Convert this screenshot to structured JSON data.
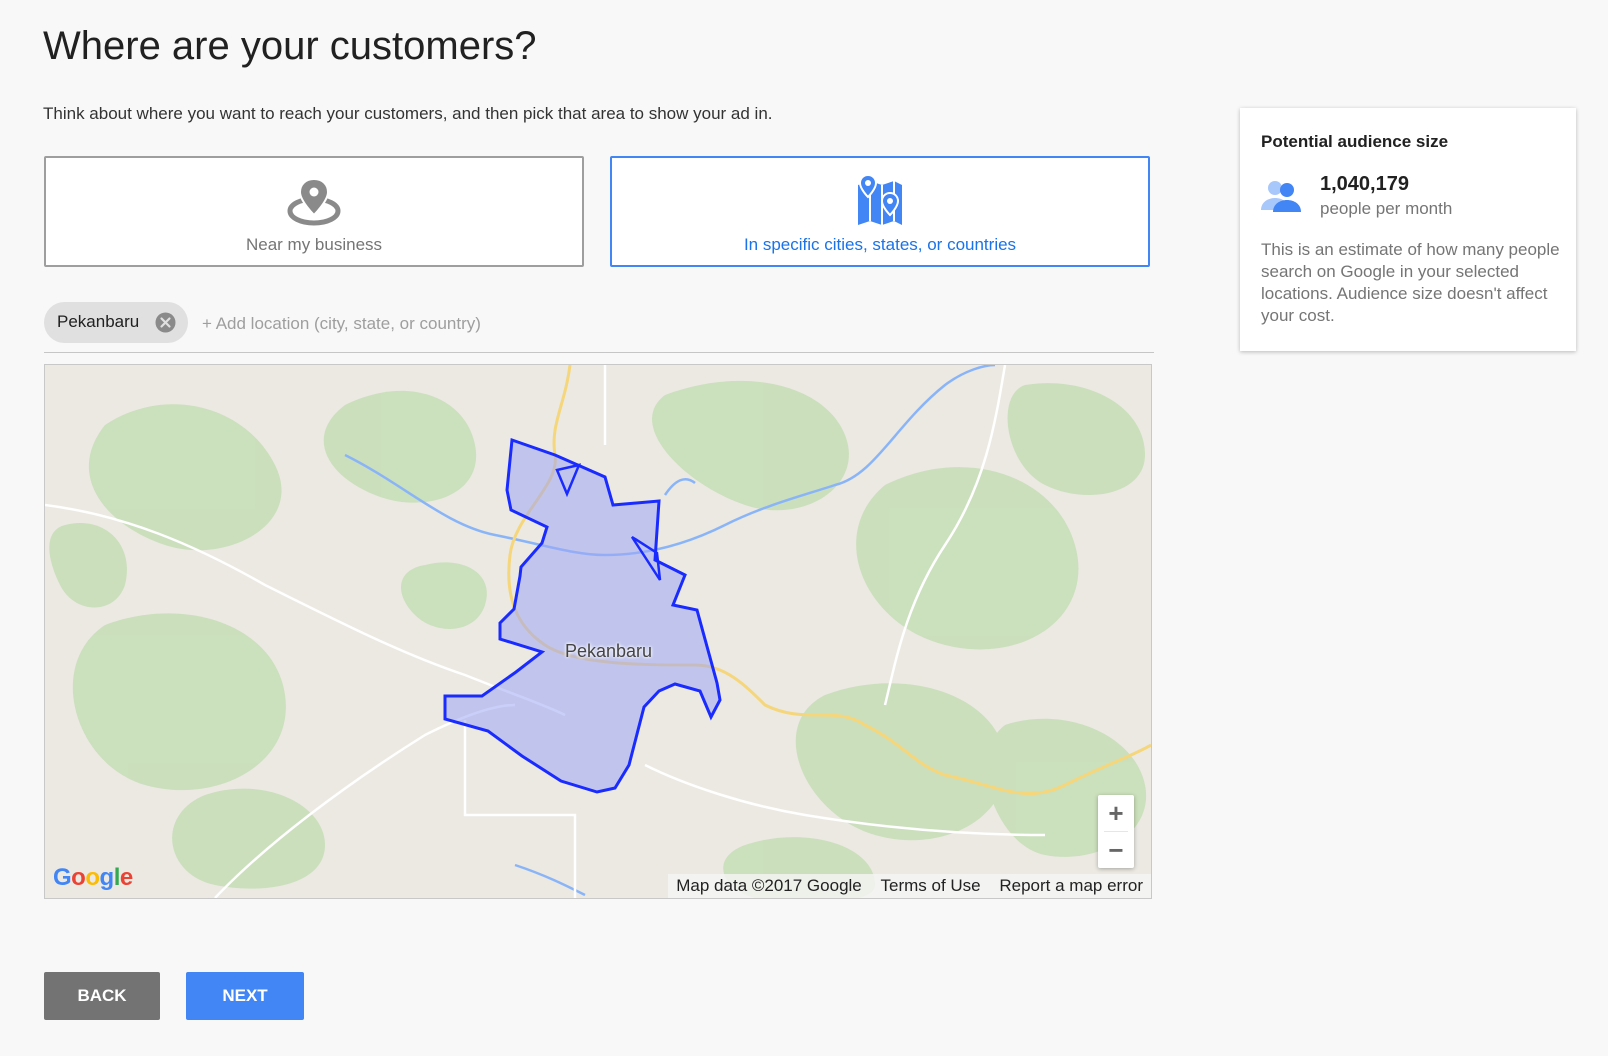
{
  "page": {
    "title": "Where are your customers?",
    "subtitle": "Think about where you want to reach your customers, and then pick that area to show your ad in."
  },
  "options": {
    "near": {
      "label": "Near my business",
      "icon": "location-target-icon",
      "selected": false
    },
    "specific": {
      "label": "In specific cities, states, or countries",
      "icon": "map-pins-icon",
      "selected": true
    }
  },
  "location": {
    "chips": [
      "Pekanbaru"
    ],
    "placeholder": "+ Add location (city, state, or country)"
  },
  "map": {
    "city_label": "Pekanbaru",
    "zoom_in": "+",
    "zoom_out": "−",
    "logo": "Google",
    "attribution": {
      "map_data": "Map data ©2017 Google",
      "terms": "Terms of Use",
      "report": "Report a map error"
    },
    "colors": {
      "land": "#ebe9e2",
      "forest": "#c8dfb8",
      "water": "#8ab4f8",
      "highway": "#f5d67b",
      "region_fill": "#9fa8f5",
      "region_stroke": "#1a2bff"
    }
  },
  "audience": {
    "title": "Potential audience size",
    "value": "1,040,179",
    "unit": "people per month",
    "description": "This is an estimate of how many people search on Google in your selected locations. Audience size doesn't affect your cost."
  },
  "buttons": {
    "back": "BACK",
    "next": "NEXT"
  },
  "colors": {
    "accent": "#4285f4",
    "back_button": "#737373"
  }
}
